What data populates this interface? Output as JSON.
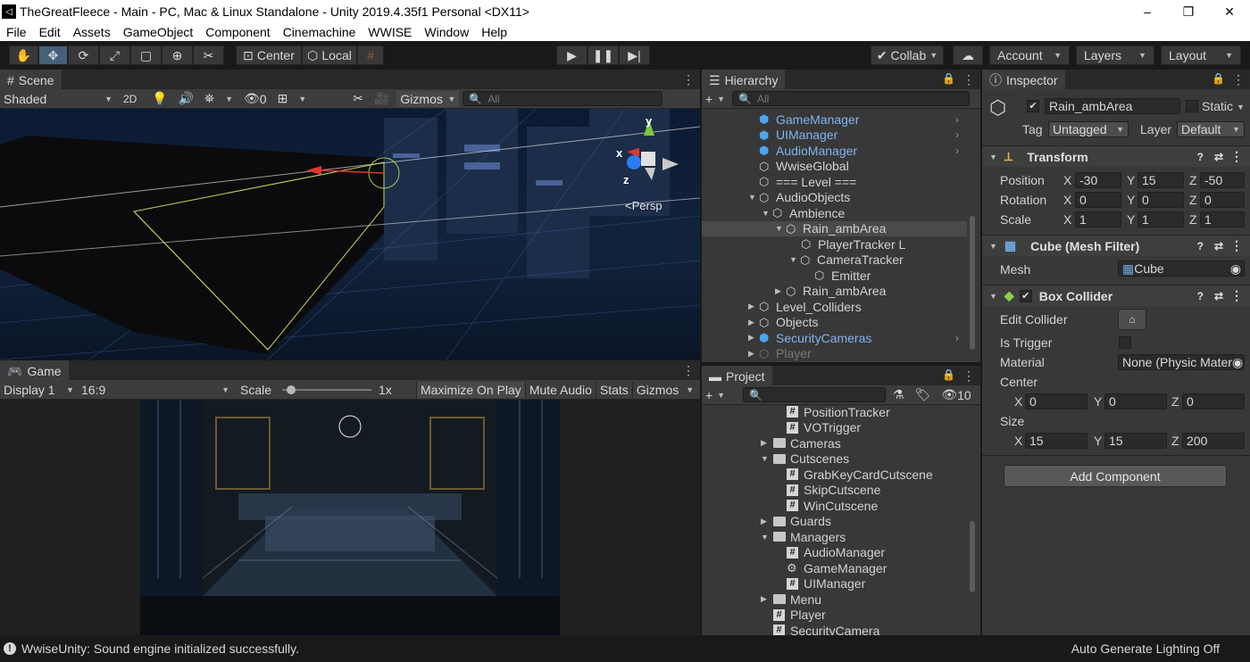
{
  "window": {
    "title": "TheGreatFleece - Main - PC, Mac & Linux Standalone - Unity 2019.4.35f1 Personal <DX11>",
    "min": "–",
    "max": "❐",
    "close": "✕"
  },
  "menu": [
    "File",
    "Edit",
    "Assets",
    "GameObject",
    "Component",
    "Cinemachine",
    "WWISE",
    "Window",
    "Help"
  ],
  "toolbar": {
    "center": "Center",
    "local": "Local",
    "collab": "Collab",
    "account": "Account",
    "layers": "Layers",
    "layout": "Layout"
  },
  "scene": {
    "tab": "Scene",
    "shading": "Shaded",
    "mode2d": "2D",
    "hidden_count": "0",
    "gizmos": "Gizmos",
    "search_placeholder": "All",
    "persp": "Persp",
    "axis_x": "x",
    "axis_y": "y",
    "axis_z": "z"
  },
  "game": {
    "tab": "Game",
    "display": "Display 1",
    "aspect": "16:9",
    "scale_label": "Scale",
    "scale_value": "1x",
    "scale_level": 0.05,
    "maximize": "Maximize On Play",
    "mute": "Mute Audio",
    "stats": "Stats",
    "gizmos": "Gizmos"
  },
  "hierarchy": {
    "tab": "Hierarchy",
    "search_placeholder": "All",
    "items": [
      {
        "label": "GameManager",
        "kind": "prefab"
      },
      {
        "label": "UIManager",
        "kind": "prefab"
      },
      {
        "label": "AudioManager",
        "kind": "prefab"
      },
      {
        "label": "WwiseGlobal",
        "kind": "object"
      },
      {
        "label": "=== Level ===",
        "kind": "object"
      },
      {
        "label": "AudioObjects",
        "kind": "object"
      },
      {
        "label": "Ambience",
        "kind": "object"
      },
      {
        "label": "Rain_ambArea",
        "kind": "object"
      },
      {
        "label": "PlayerTracker L",
        "kind": "object"
      },
      {
        "label": "CameraTracker",
        "kind": "object"
      },
      {
        "label": "Emitter",
        "kind": "object"
      },
      {
        "label": "Rain_ambArea",
        "kind": "object"
      },
      {
        "label": "Level_Colliders",
        "kind": "object"
      },
      {
        "label": "Objects",
        "kind": "object"
      },
      {
        "label": "SecurityCameras",
        "kind": "prefab"
      },
      {
        "label": "Player",
        "kind": "disabled"
      }
    ]
  },
  "project": {
    "tab": "Project",
    "hidden_count": "10",
    "items": [
      {
        "label": "PositionTracker",
        "kind": "script"
      },
      {
        "label": "VOTrigger",
        "kind": "script"
      },
      {
        "label": "Cameras",
        "kind": "folder"
      },
      {
        "label": "Cutscenes",
        "kind": "folder"
      },
      {
        "label": "GrabKeyCardCutscene",
        "kind": "script"
      },
      {
        "label": "SkipCutscene",
        "kind": "script"
      },
      {
        "label": "WinCutscene",
        "kind": "script"
      },
      {
        "label": "Guards",
        "kind": "folder"
      },
      {
        "label": "Managers",
        "kind": "folder"
      },
      {
        "label": "AudioManager",
        "kind": "script"
      },
      {
        "label": "GameManager",
        "kind": "gear"
      },
      {
        "label": "UIManager",
        "kind": "script"
      },
      {
        "label": "Menu",
        "kind": "folder"
      },
      {
        "label": "Player",
        "kind": "script"
      },
      {
        "label": "SecurityCamera",
        "kind": "script"
      }
    ]
  },
  "inspector": {
    "tab": "Inspector",
    "object_name": "Rain_ambArea",
    "static_label": "Static",
    "tag_label": "Tag",
    "tag_value": "Untagged",
    "layer_label": "Layer",
    "layer_value": "Default",
    "transform": {
      "title": "Transform",
      "position_label": "Position",
      "rotation_label": "Rotation",
      "scale_label": "Scale",
      "position": {
        "x": "-30",
        "y": "15",
        "z": "-50"
      },
      "rotation": {
        "x": "0",
        "y": "0",
        "z": "0"
      },
      "scale": {
        "x": "1",
        "y": "1",
        "z": "1"
      }
    },
    "mesh_filter": {
      "title": "Cube (Mesh Filter)",
      "mesh_label": "Mesh",
      "mesh_value": "Cube"
    },
    "box_collider": {
      "title": "Box Collider",
      "edit_label": "Edit Collider",
      "trigger_label": "Is Trigger",
      "material_label": "Material",
      "material_value": "None (Physic Mater",
      "center_label": "Center",
      "size_label": "Size",
      "center": {
        "x": "0",
        "y": "0",
        "z": "0"
      },
      "size": {
        "x": "15",
        "y": "15",
        "z": "200"
      }
    },
    "add_component": "Add Component",
    "axis": {
      "x": "X",
      "y": "Y",
      "z": "Z"
    }
  },
  "status": {
    "message": "WwiseUnity: Sound engine initialized successfully.",
    "lighting": "Auto Generate Lighting Off"
  }
}
